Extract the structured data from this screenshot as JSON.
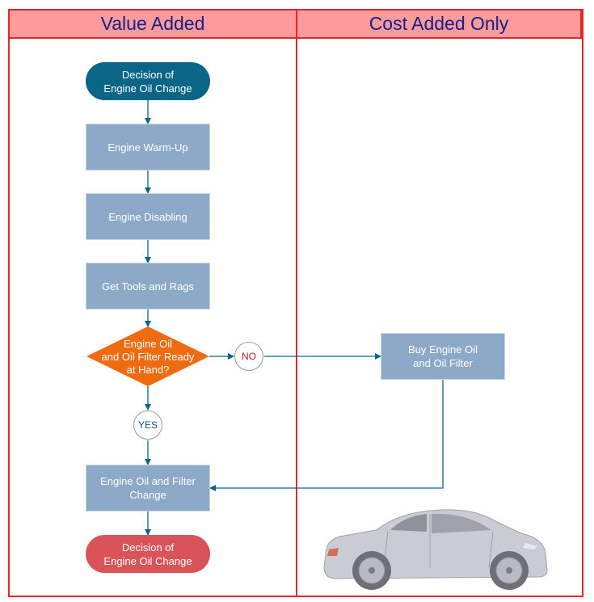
{
  "lanes": [
    {
      "title": "Value Added"
    },
    {
      "title": "Cost Added Only"
    }
  ],
  "nodes": {
    "start": {
      "label_line1": "Decision of",
      "label_line2": "Engine Oil Change",
      "type": "terminator"
    },
    "warmup": {
      "label": "Engine Warm-Up",
      "type": "process"
    },
    "disabling": {
      "label": "Engine Disabling",
      "type": "process"
    },
    "tools": {
      "label": "Get Tools and Rags",
      "type": "process"
    },
    "decision": {
      "label_line1": "Engine Oil",
      "label_line2": "and Oil Filter Ready",
      "label_line3": "at Hand?",
      "type": "decision"
    },
    "buy": {
      "label_line1": "Buy Engine Oil",
      "label_line2": "and Oil Filter",
      "type": "process"
    },
    "change": {
      "label_line1": "Engine Oil and Filter",
      "label_line2": "Change",
      "type": "process"
    },
    "end": {
      "label_line1": "Decision of",
      "label_line2": "Engine Oil Change",
      "type": "terminator"
    }
  },
  "connectors": {
    "no": "NO",
    "yes": "YES"
  },
  "colors": {
    "lane_border": "#e8252b",
    "lane_header_bg": "#fd9a9a",
    "lane_header_text": "#16208a",
    "start_terminator": "#0b6587",
    "end_terminator": "#d85458",
    "process": "#8ca9c8",
    "decision": "#ef6b12",
    "arrow": "#0b6587"
  },
  "illustration": "car-icon"
}
